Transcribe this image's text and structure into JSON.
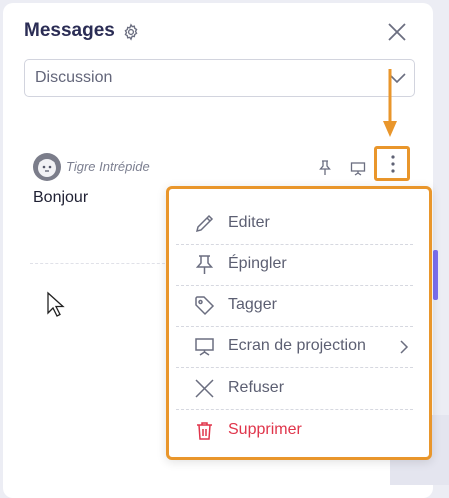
{
  "header": {
    "title": "Messages"
  },
  "select": {
    "value": "Discussion"
  },
  "message": {
    "author": "Tigre Intrépide",
    "text": "Bonjour"
  },
  "menu": {
    "items": [
      {
        "label": "Editer",
        "icon": "pencil-icon"
      },
      {
        "label": "Épingler",
        "icon": "pin-icon"
      },
      {
        "label": "Tagger",
        "icon": "tag-icon"
      },
      {
        "label": "Ecran de projection",
        "icon": "projector-icon",
        "submenu": true
      },
      {
        "label": "Refuser",
        "icon": "x-icon"
      },
      {
        "label": "Supprimer",
        "icon": "trash-icon",
        "danger": true
      }
    ]
  },
  "colors": {
    "title": "#2b2d55",
    "highlight": "#e9962b",
    "danger": "#e0354b",
    "accent": "#7b6ff0"
  }
}
